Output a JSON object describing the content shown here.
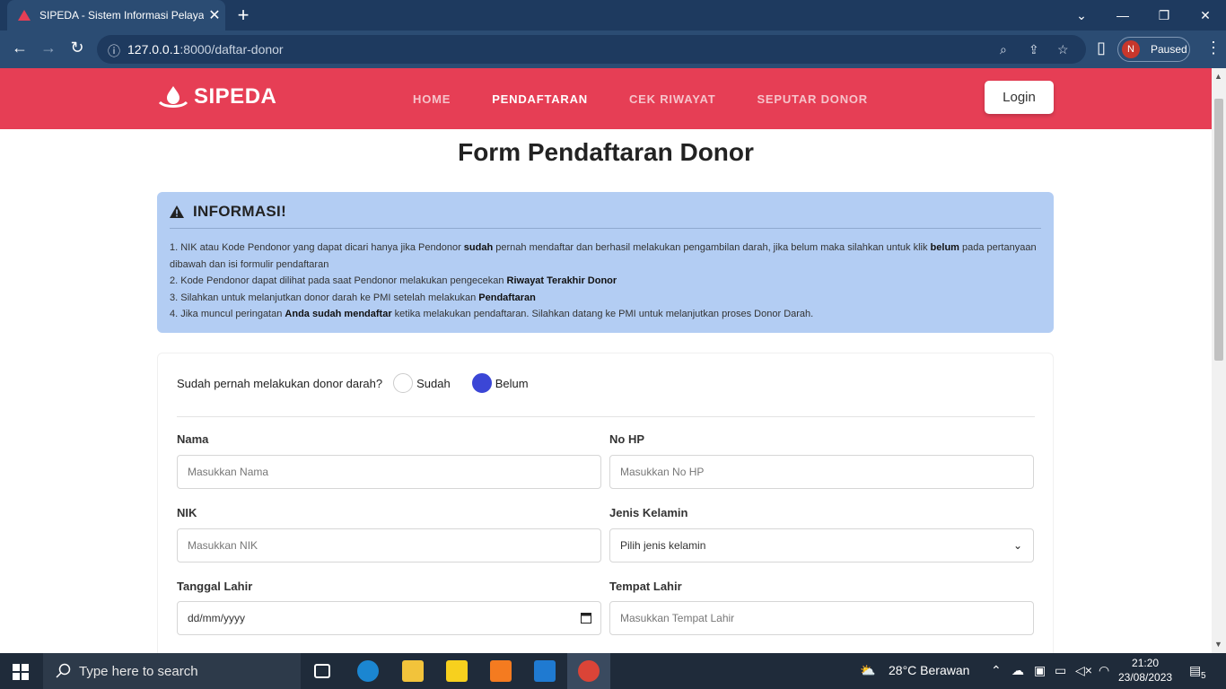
{
  "browser": {
    "tab_title": "SIPEDA - Sistem Informasi Pelaya",
    "url_host": "127.0.0.1",
    "url_path": ":8000/daftar-donor",
    "profile_initial": "N",
    "profile_status": "Paused"
  },
  "navbar": {
    "brand": "SIPEDA",
    "items": [
      "HOME",
      "PENDAFTARAN",
      "CEK RIWAYAT",
      "SEPUTAR DONOR"
    ],
    "active_item": "PENDAFTARAN",
    "login_label": "Login"
  },
  "page": {
    "title": "Form Pendaftaran Donor"
  },
  "info": {
    "heading": "INFORMASI!",
    "line1_a": "1. NIK atau Kode Pendonor yang dapat dicari hanya jika Pendonor ",
    "line1_b": "sudah",
    "line1_c": " pernah mendaftar dan berhasil melakukan pengambilan darah, jika belum maka silahkan untuk klik ",
    "line1_d": "belum",
    "line1_e": " pada pertanyaan dibawah dan isi formulir pendaftaran",
    "line2_a": "2. Kode Pendonor dapat dilihat pada saat Pendonor melakukan pengecekan ",
    "line2_b": "Riwayat Terakhir Donor",
    "line3_a": "3. Silahkan untuk melanjutkan donor darah ke PMI setelah melakukan ",
    "line3_b": "Pendaftaran",
    "line4_a": "4. Jika muncul peringatan ",
    "line4_b": "Anda sudah mendaftar",
    "line4_c": " ketika melakukan pendaftaran. Silahkan datang ke PMI untuk melanjutkan proses Donor Darah."
  },
  "form": {
    "question": "Sudah pernah melakukan donor darah?",
    "option_yes": "Sudah",
    "option_no": "Belum",
    "selected": "Belum",
    "nama_label": "Nama",
    "nama_placeholder": "Masukkan Nama",
    "hp_label": "No HP",
    "hp_placeholder": "Masukkan No HP",
    "nik_label": "NIK",
    "nik_placeholder": "Masukkan NIK",
    "jk_label": "Jenis Kelamin",
    "jk_value": "Pilih jenis kelamin",
    "tgl_label": "Tanggal Lahir",
    "tgl_value": "dd/mm/yyyy",
    "tempat_label": "Tempat Lahir",
    "tempat_placeholder": "Masukkan Tempat Lahir"
  },
  "taskbar": {
    "search_placeholder": "Type here to search",
    "weather": "28°C  Berawan",
    "time": "21:20",
    "date": "23/08/2023",
    "notifications": "5"
  },
  "colors": {
    "navbar": "#e63e55",
    "alert_bg": "#b3cdf3",
    "radio_active": "#3b46d6"
  }
}
